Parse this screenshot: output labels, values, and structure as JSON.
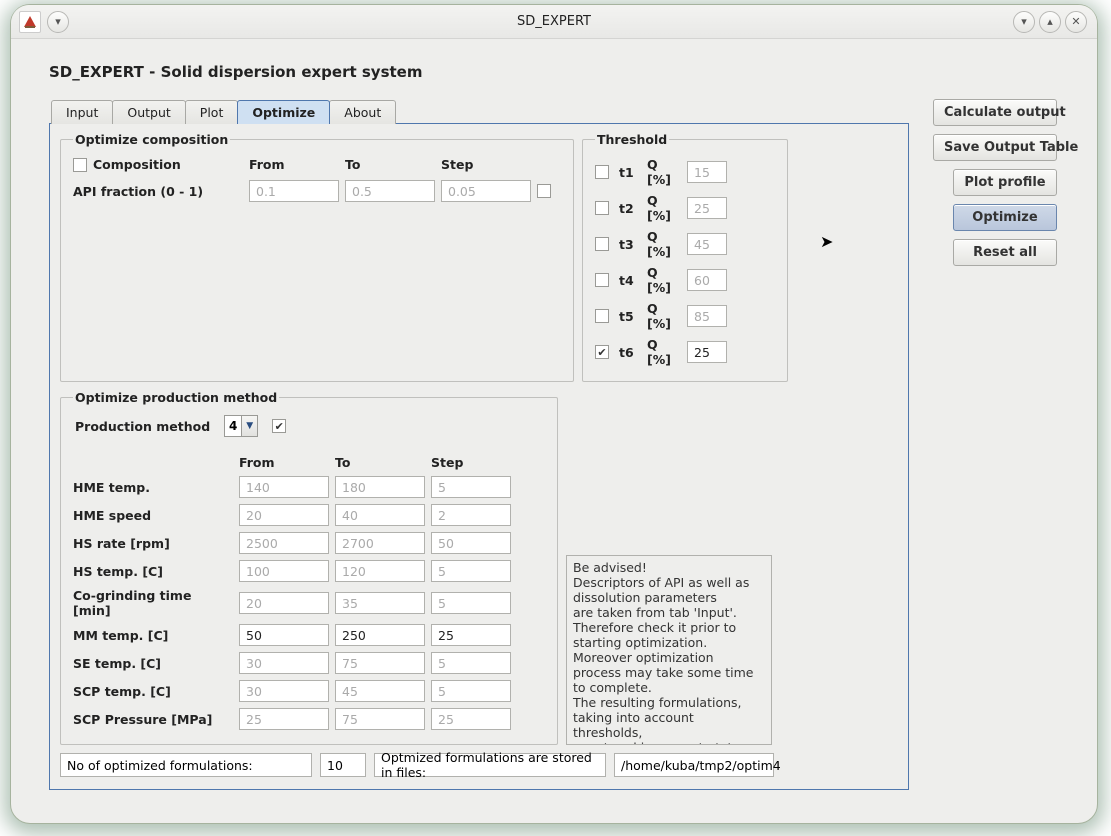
{
  "window": {
    "title": "SD_EXPERT"
  },
  "page_title": "SD_EXPERT - Solid dispersion expert system",
  "tabs": [
    "Input",
    "Output",
    "Plot",
    "Optimize",
    "About"
  ],
  "active_tab": "Optimize",
  "side_buttons": {
    "calculate": "Calculate output",
    "save": "Save Output Table",
    "plot": "Plot profile",
    "optimize": "Optimize",
    "reset": "Reset all"
  },
  "optimize_comp": {
    "legend": "Optimize composition",
    "checkbox_label": "Composition",
    "col_from": "From",
    "col_to": "To",
    "col_step": "Step",
    "api_label": "API fraction (0 - 1)",
    "api_from": "0.1",
    "api_to": "0.5",
    "api_step": "0.05"
  },
  "optimize_prod": {
    "legend": "Optimize production method",
    "method_label": "Production method",
    "method_value": "4",
    "col_from": "From",
    "col_to": "To",
    "col_step": "Step",
    "rows": [
      {
        "label": "HME temp.",
        "from": "140",
        "to": "180",
        "step": "5",
        "disabled": true
      },
      {
        "label": "HME speed",
        "from": "20",
        "to": "40",
        "step": "2",
        "disabled": true
      },
      {
        "label": "HS rate [rpm]",
        "from": "2500",
        "to": "2700",
        "step": "50",
        "disabled": true
      },
      {
        "label": "HS temp. [C]",
        "from": "100",
        "to": "120",
        "step": "5",
        "disabled": true
      },
      {
        "label": "Co-grinding time [min]",
        "from": "20",
        "to": "35",
        "step": "5",
        "disabled": true
      },
      {
        "label": "MM temp. [C]",
        "from": "50",
        "to": "250",
        "step": "25",
        "disabled": false
      },
      {
        "label": "SE temp. [C]",
        "from": "30",
        "to": "75",
        "step": "5",
        "disabled": true
      },
      {
        "label": "SCP temp. [C]",
        "from": "30",
        "to": "45",
        "step": "5",
        "disabled": true
      },
      {
        "label": "SCP Pressure [MPa]",
        "from": "25",
        "to": "75",
        "step": "25",
        "disabled": true
      }
    ]
  },
  "threshold": {
    "legend": "Threshold",
    "q_label": "Q [%]",
    "rows": [
      {
        "name": "t1",
        "value": "15",
        "checked": false
      },
      {
        "name": "t2",
        "value": "25",
        "checked": false
      },
      {
        "name": "t3",
        "value": "45",
        "checked": false
      },
      {
        "name": "t4",
        "value": "60",
        "checked": false
      },
      {
        "name": "t5",
        "value": "85",
        "checked": false
      },
      {
        "name": "t6",
        "value": "25",
        "checked": true
      }
    ]
  },
  "note": "Be advised!\nDescriptors of API as well as dissolution parameters\nare taken from tab 'Input'.\nTherefore check it prior to starting optimization.\nMoreover optimization process may take some time to complete.\nThe resulting formulations,\ntaking into account thresholds,\nare stored in separate txt files.",
  "bottom": {
    "label1": "No of optimized formulations:",
    "value1": "10",
    "label2": "Optmized formulations are stored in files:",
    "value2": "/home/kuba/tmp2/optim4"
  }
}
